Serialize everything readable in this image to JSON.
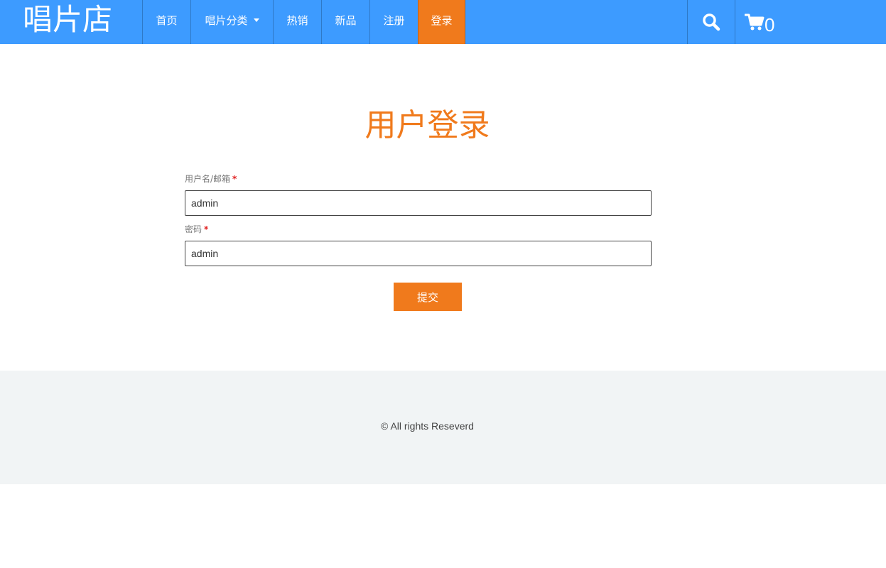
{
  "header": {
    "brand": "唱片店",
    "nav": [
      {
        "label": "首页",
        "active": false
      },
      {
        "label": "唱片分类",
        "dropdown": true,
        "active": false
      },
      {
        "label": "热销",
        "active": false
      },
      {
        "label": "新品",
        "active": false
      },
      {
        "label": "注册",
        "active": false
      },
      {
        "label": "登录",
        "active": true
      }
    ],
    "search_icon": "search-icon",
    "cart_icon": "cart-icon",
    "cart_count": "0"
  },
  "login": {
    "title": "用户登录",
    "username_label": "用户名/邮箱",
    "username_value": "admin",
    "password_label": "密码",
    "password_value": "admin",
    "required_mark": "*",
    "submit_label": "提交"
  },
  "footer": {
    "copyright": "© All rights Reseverd"
  },
  "colors": {
    "nav_bg": "#3d9bff",
    "accent": "#f07a1c",
    "footer_bg": "#f1f4f5"
  }
}
